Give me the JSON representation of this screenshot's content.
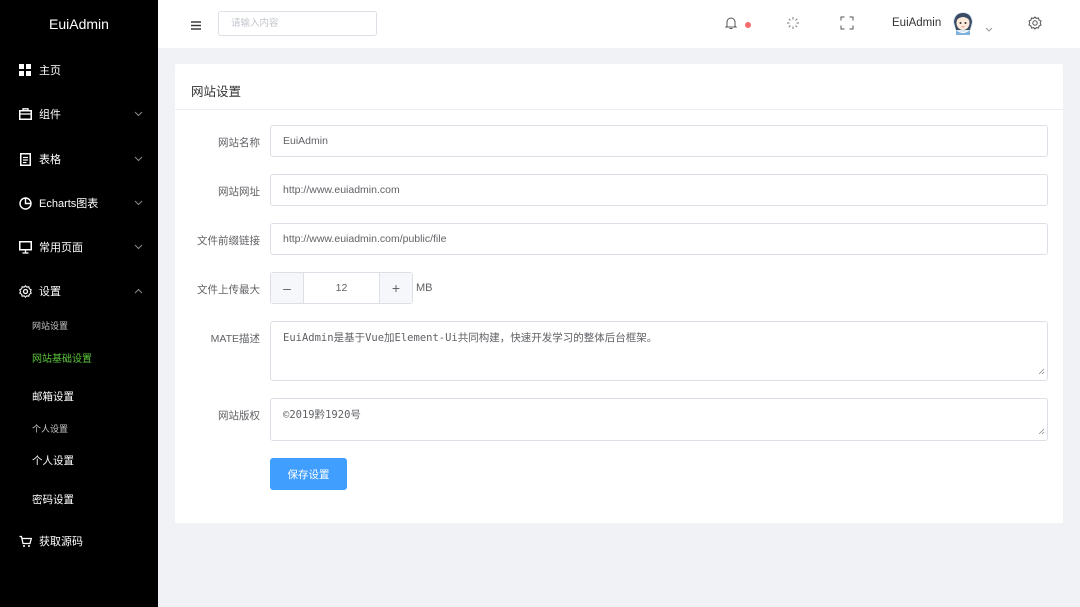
{
  "app": {
    "title": "EuiAdmin"
  },
  "sidebar": {
    "items": [
      {
        "label": "主页",
        "icon": "grid-icon"
      },
      {
        "label": "组件",
        "icon": "briefcase-icon"
      },
      {
        "label": "表格",
        "icon": "document-icon"
      },
      {
        "label": "Echarts图表",
        "icon": "pie-chart-icon"
      },
      {
        "label": "常用页面",
        "icon": "monitor-icon"
      },
      {
        "label": "设置",
        "icon": "gear-icon"
      }
    ],
    "settings_children": [
      "网站设置",
      "网站基础设置",
      "邮箱设置",
      "个人设置",
      "个人设置",
      "密码设置"
    ],
    "source": {
      "label": "获取源码",
      "icon": "cart-icon"
    }
  },
  "header": {
    "search_placeholder": "请输入内容",
    "user_name": "EuiAdmin"
  },
  "form": {
    "card_title": "网站设置",
    "fields": {
      "site_name": {
        "label": "网站名称",
        "value": "EuiAdmin"
      },
      "site_url": {
        "label": "网站网址",
        "value": "http://www.euiadmin.com"
      },
      "file_prefix": {
        "label": "文件前缀链接",
        "value": "http://www.euiadmin.com/public/file"
      },
      "upload_max": {
        "label": "文件上传最大",
        "value": "12",
        "unit": "MB"
      },
      "meta": {
        "label": "MATE描述",
        "value": "EuiAdmin是基于Vue加Element-Ui共同构建，快速开发学习的整体后台框架。"
      },
      "copyright": {
        "label": "网站版权",
        "value": "©2019黔1920号"
      }
    },
    "save_label": "保存设置"
  },
  "colors": {
    "sidebar_bg": "#000000",
    "active": "#5cc63c",
    "primary": "#409eff",
    "badge": "#f56c6c"
  }
}
